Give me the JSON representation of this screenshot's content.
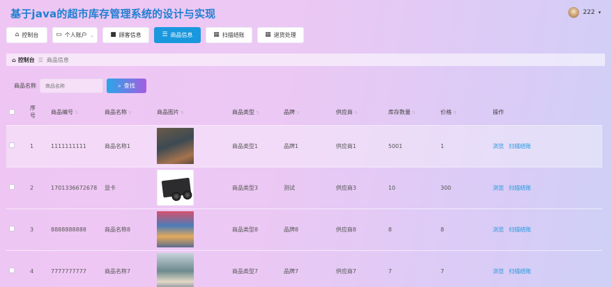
{
  "app": {
    "title": "基于java的超市库存管理系统的设计与实现"
  },
  "user": {
    "name": "222",
    "avatar_icon": "avatar-icon",
    "caret": "▾"
  },
  "nav": [
    {
      "label": "控制台",
      "icon": "home-icon",
      "active": false
    },
    {
      "label": "个人账户",
      "icon": "window-icon",
      "active": false,
      "dropdown": true
    },
    {
      "label": "顾客信息",
      "icon": "briefcase-icon",
      "active": false
    },
    {
      "label": "商品信息",
      "icon": "sliders-icon",
      "active": true
    },
    {
      "label": "扫描结账",
      "icon": "grid-icon",
      "active": false
    },
    {
      "label": "退货处理",
      "icon": "grid-icon",
      "active": false
    }
  ],
  "breadcrumb": {
    "home": "控制台",
    "separator": "☰",
    "current": "商品信息"
  },
  "search": {
    "label": "商品名称",
    "placeholder": "商品名称",
    "button": "查找"
  },
  "table": {
    "columns": [
      "序号",
      "商品编号",
      "商品名称",
      "商品图片",
      "商品类型",
      "品牌",
      "供应商",
      "库存数量",
      "价格",
      "操作"
    ],
    "rows": [
      {
        "index": "1",
        "code": "1111111111",
        "name": "商品名称1",
        "type": "商品类型1",
        "brand": "品牌1",
        "supplier": "供应商1",
        "stock": "5001",
        "price": "1"
      },
      {
        "index": "2",
        "code": "1701336672678",
        "name": "显卡",
        "type": "商品类型3",
        "brand": "测试",
        "supplier": "供应商3",
        "stock": "10",
        "price": "300"
      },
      {
        "index": "3",
        "code": "8888888888",
        "name": "商品名称8",
        "type": "商品类型8",
        "brand": "品牌8",
        "supplier": "供应商8",
        "stock": "8",
        "price": "8"
      },
      {
        "index": "4",
        "code": "7777777777",
        "name": "商品名称7",
        "type": "商品类型7",
        "brand": "品牌7",
        "supplier": "供应商7",
        "stock": "7",
        "price": "7"
      }
    ],
    "actions": {
      "view": "浏览",
      "checkout": "扫描结账"
    }
  },
  "colors": {
    "accent": "#1a98de",
    "title": "#1f7fd1",
    "search_gradient": [
      "#2aa6e8",
      "#a35de0"
    ]
  }
}
